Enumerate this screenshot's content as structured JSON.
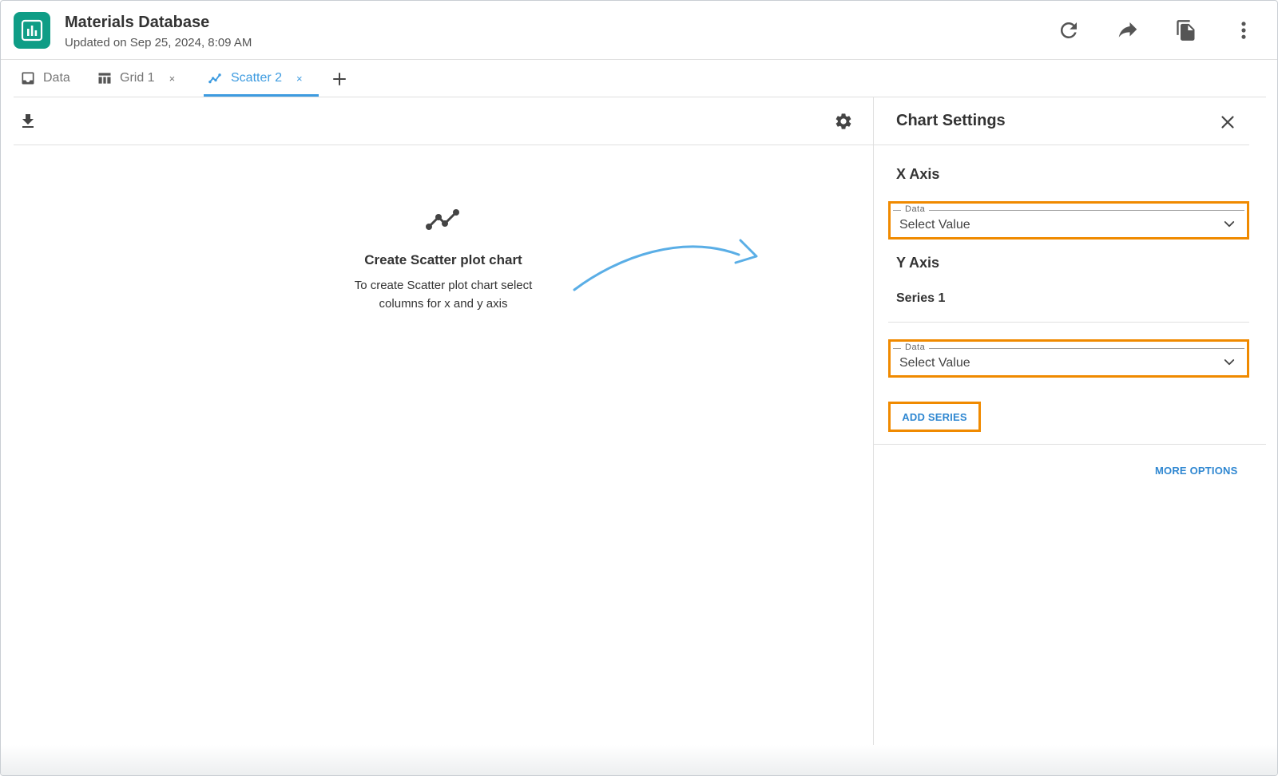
{
  "header": {
    "title": "Materials Database",
    "subtitle": "Updated on Sep 25, 2024, 8:09 AM",
    "icons": [
      "refresh-icon",
      "share-icon",
      "copy-icon",
      "more-vert-icon"
    ]
  },
  "tabs": [
    {
      "label": "Data",
      "icon": "inbox-icon",
      "closable": false
    },
    {
      "label": "Grid 1",
      "icon": "table-icon",
      "closable": true,
      "close_label": "×"
    },
    {
      "label": "Scatter 2",
      "icon": "scatter-icon",
      "closable": true,
      "close_label": "×",
      "active": true
    }
  ],
  "empty_state": {
    "title": "Create Scatter plot chart",
    "description": "To create Scatter plot chart select columns for x and y axis"
  },
  "chart_settings": {
    "title": "Chart Settings",
    "x_axis": {
      "label": "X Axis",
      "field_legend": "Data",
      "field_value": "Select Value"
    },
    "y_axis": {
      "label": "Y Axis",
      "series_label": "Series 1",
      "field_legend": "Data",
      "field_value": "Select Value"
    },
    "add_series_label": "ADD SERIES",
    "more_options_label": "MORE OPTIONS"
  },
  "colors": {
    "accent": "#3d9be0",
    "link": "#2f87d1",
    "highlight": "#f08a00",
    "logo": "#0f9d86"
  }
}
